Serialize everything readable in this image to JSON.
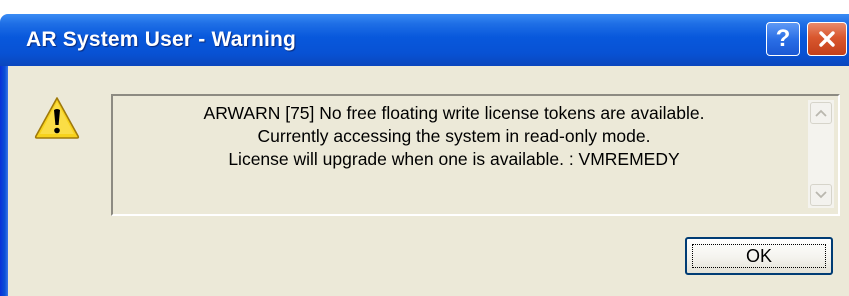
{
  "window": {
    "title": "AR System User - Warning",
    "help_label": "?"
  },
  "message": {
    "lines": [
      "ARWARN [75] No free floating write license tokens are available.",
      "Currently accessing the system in read-only mode.",
      "License will upgrade when one is available. : VMREMEDY"
    ]
  },
  "icons": {
    "dialog_icon": "warning-icon",
    "close": "close-icon",
    "help": "help-icon",
    "scroll_up": "chevron-up-icon",
    "scroll_down": "chevron-down-icon"
  },
  "buttons": {
    "ok_label": "OK"
  },
  "colors": {
    "titlebar": "#0858dc",
    "dialog_bg": "#ece9d8",
    "close_button": "#d9572e",
    "warning_yellow": "#f7d21c"
  }
}
